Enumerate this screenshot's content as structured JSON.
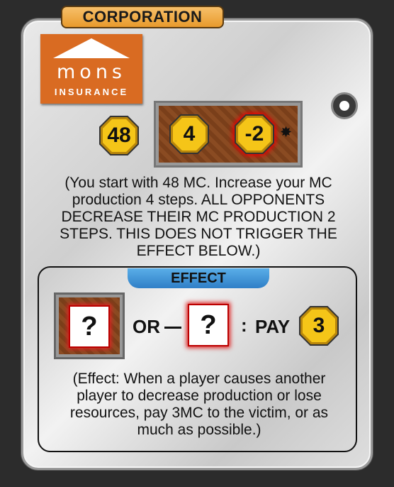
{
  "card": {
    "type_label": "CORPORATION",
    "logo": {
      "name": "mons",
      "subtitle": "INSURANCE"
    },
    "starting_mc": "48",
    "production": {
      "own": "4",
      "opponents": "-2",
      "marker": "✸"
    },
    "description": [
      "(You start with 48 MC. Increase your MC",
      "production 4 steps. ALL OPPONENTS",
      "DECREASE THEIR MC PRODUCTION 2",
      "STEPS. THIS DOES NOT TRIGGER THE",
      "EFFECT BELOW.)"
    ],
    "effect": {
      "label": "EFFECT",
      "left_symbol": "?",
      "or_label": "OR",
      "right_symbol": "?",
      "colon": ":",
      "pay_label": "PAY",
      "pay_amount": "3",
      "description": [
        "(Effect: When a player causes another",
        "player to decrease production or lose",
        "resources, pay 3MC to the victim, or as",
        "much as possible.)"
      ]
    }
  },
  "colors": {
    "background": "#2c2c2c",
    "banner": "#e89a2c",
    "logo": "#d96b22",
    "effect_tab": "#2f7fc7",
    "mc_gold": "#f5c518",
    "production_brown": "#8a4b22"
  }
}
